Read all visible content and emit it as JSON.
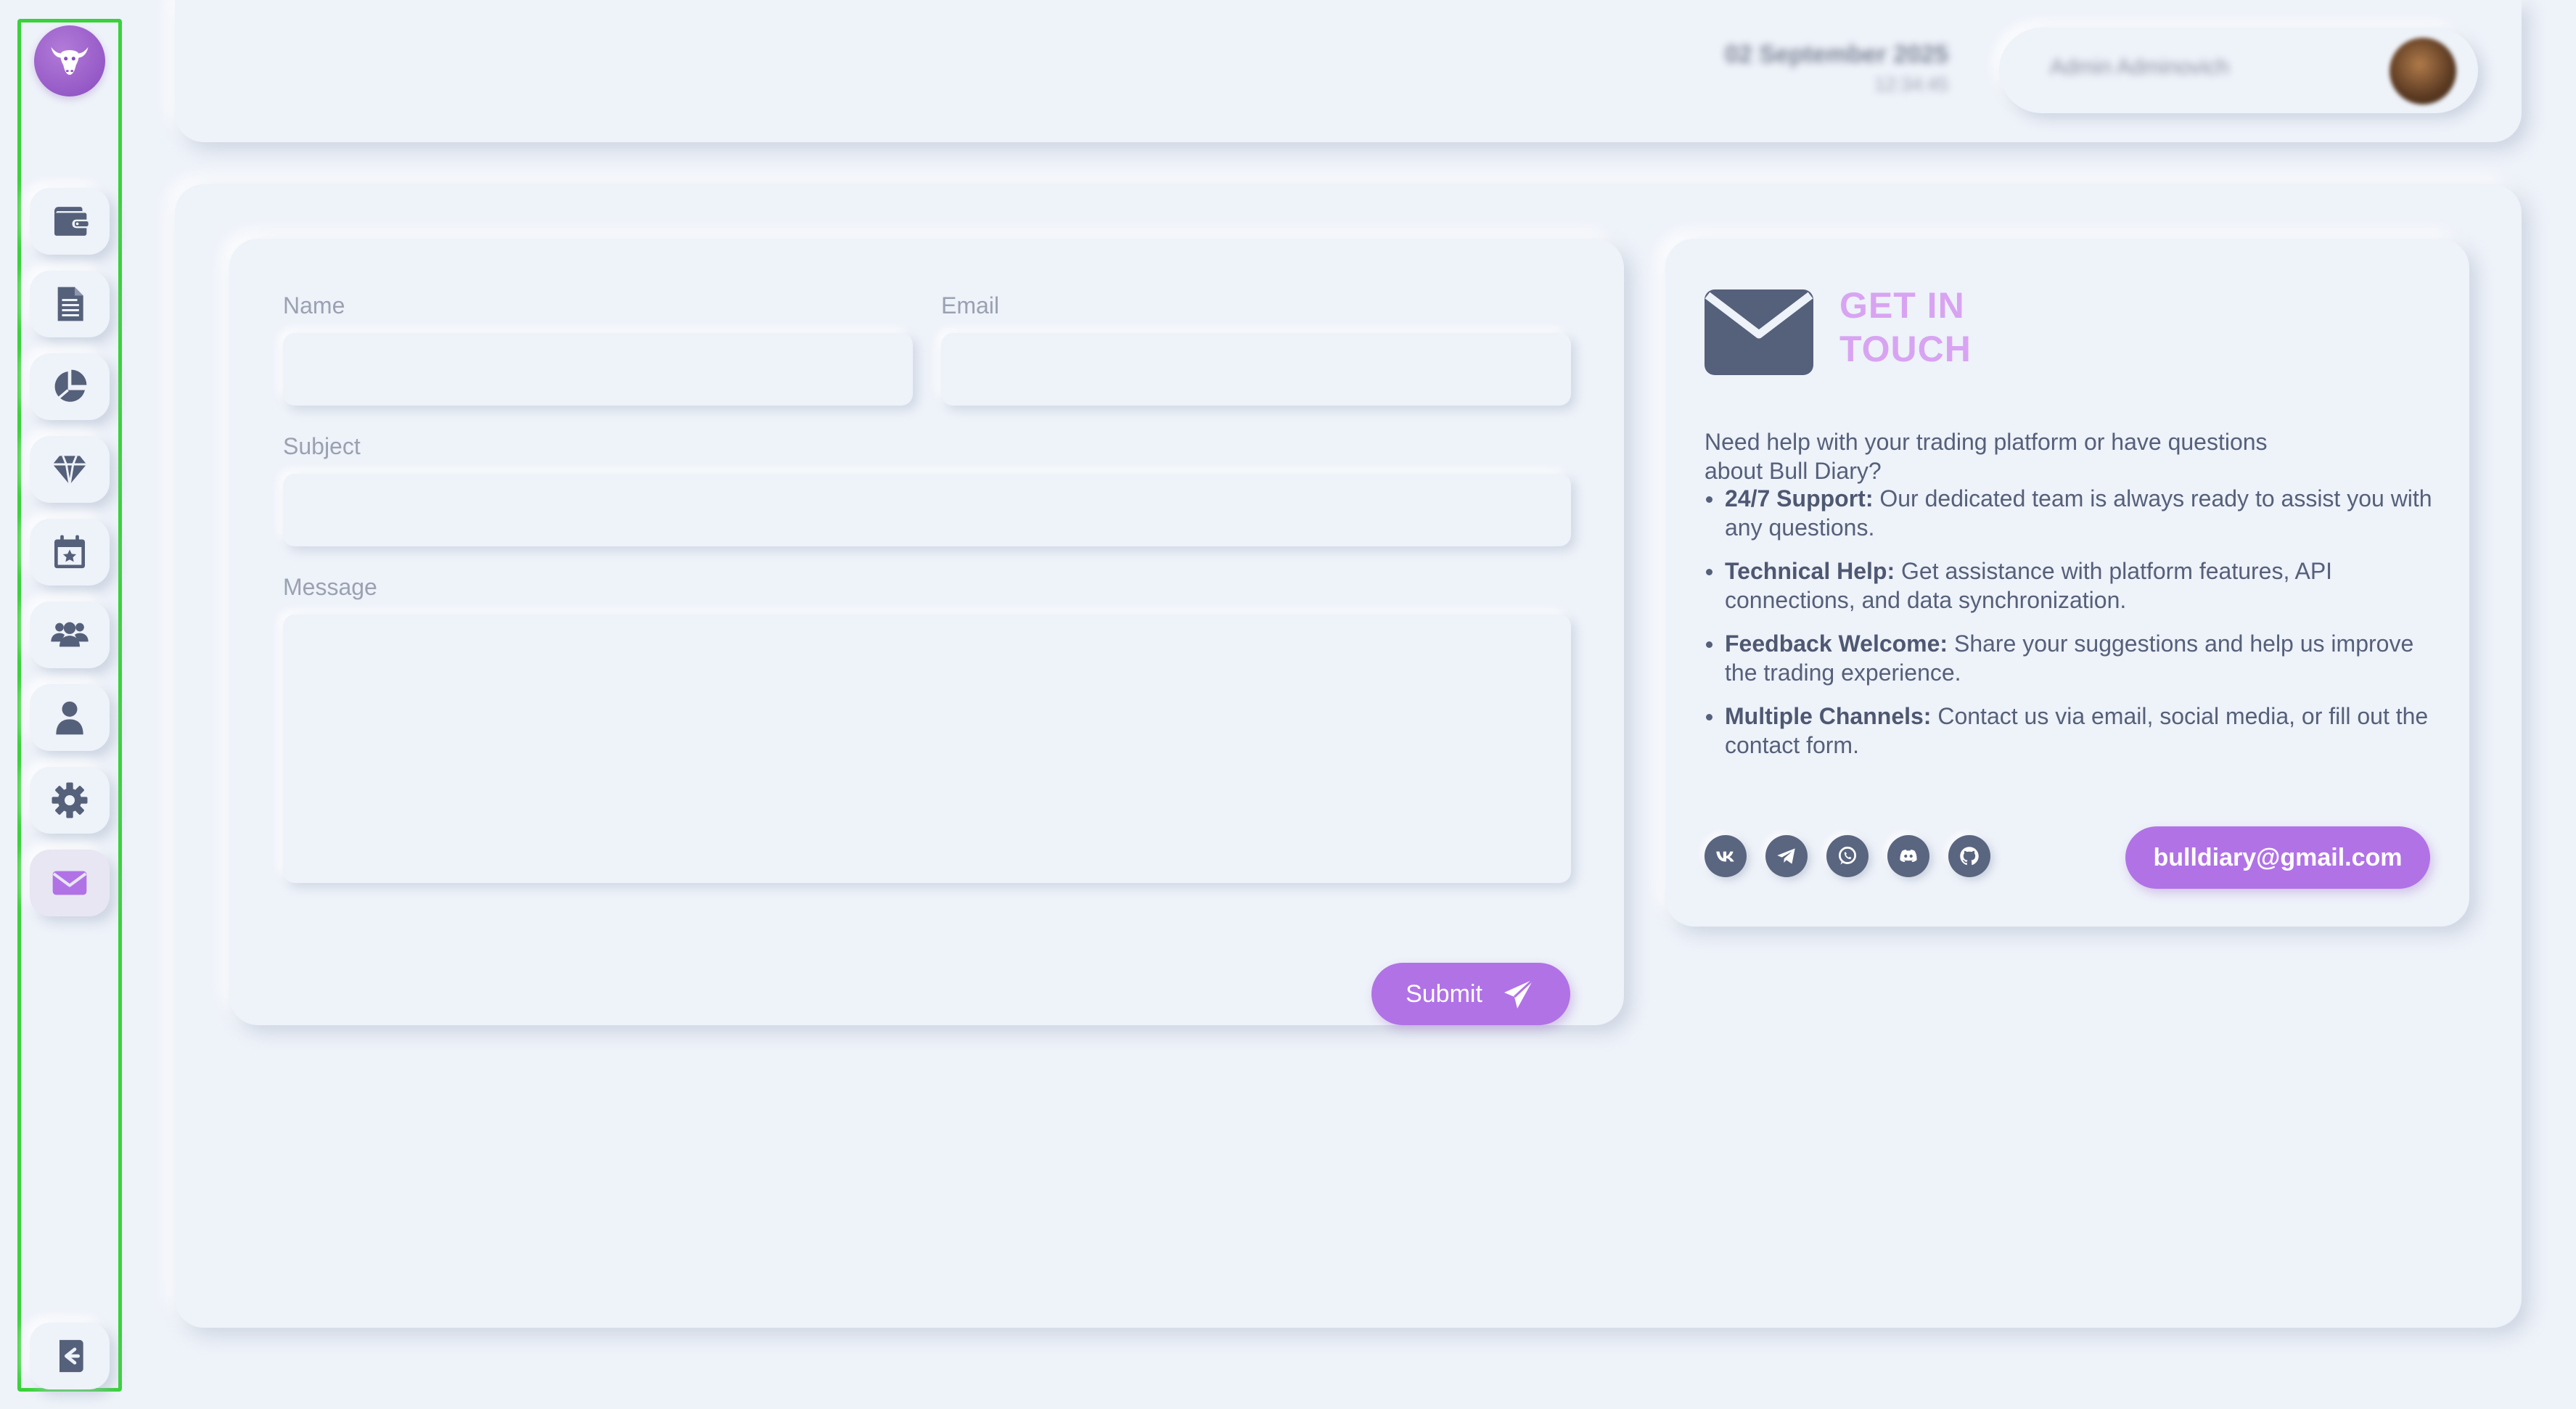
{
  "header": {
    "date": "02 September 2025",
    "time": "12:34:45",
    "user_name": "Admin Adminovich"
  },
  "sidebar": {
    "items": [
      {
        "icon": "wallet-icon"
      },
      {
        "icon": "document-icon"
      },
      {
        "icon": "pie-chart-icon"
      },
      {
        "icon": "diamond-icon"
      },
      {
        "icon": "calendar-star-icon"
      },
      {
        "icon": "users-icon"
      },
      {
        "icon": "user-icon"
      },
      {
        "icon": "gear-icon"
      },
      {
        "icon": "envelope-icon",
        "active": true
      }
    ],
    "logout_icon": "logout-icon"
  },
  "form": {
    "name_label": "Name",
    "email_label": "Email",
    "subject_label": "Subject",
    "message_label": "Message",
    "name_value": "",
    "email_value": "",
    "subject_value": "",
    "message_value": "",
    "submit_label": "Submit"
  },
  "info": {
    "title": "GET IN TOUCH",
    "description": "Need help with your trading platform or have questions about Bull Diary?",
    "points": [
      {
        "bold": "24/7 Support:",
        "text": " Our dedicated team is always ready to assist you with any questions."
      },
      {
        "bold": "Technical Help:",
        "text": " Get assistance with platform features, API connections, and data synchronization."
      },
      {
        "bold": "Feedback Welcome:",
        "text": " Share your suggestions and help us improve the trading experience."
      },
      {
        "bold": "Multiple Channels:",
        "text": " Contact us via email, social media, or fill out the contact form."
      }
    ],
    "socials": [
      "vk-icon",
      "telegram-icon",
      "whatsapp-icon",
      "discord-icon",
      "github-icon"
    ],
    "email": "bulldiary@gmail.com"
  },
  "colors": {
    "background": "#eef2f9",
    "accent": "#b172e6",
    "title_accent": "#d8a4f2",
    "icon": "#55607a",
    "sidebar_highlight": "#39d23a"
  }
}
